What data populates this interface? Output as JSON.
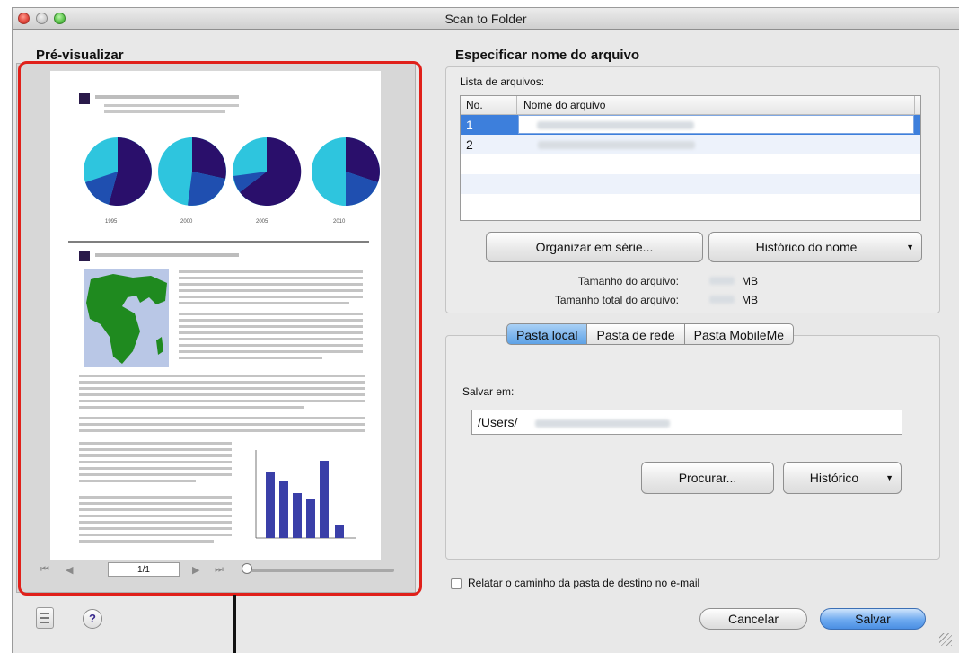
{
  "window": {
    "title": "Scan to Folder"
  },
  "preview": {
    "title": "Pré-visualizar",
    "page_indicator": "1/1",
    "chart_years": [
      "1995",
      "2000",
      "2005",
      "2010"
    ]
  },
  "filename_section": {
    "title": "Especificar nome do arquivo",
    "list_label": "Lista de arquivos:",
    "columns": [
      "No.",
      "Nome do arquivo"
    ],
    "rows": [
      {
        "no": "1"
      },
      {
        "no": "2"
      }
    ],
    "organize_button": "Organizar em série...",
    "history_button": "Histórico do nome",
    "file_size_label": "Tamanho do arquivo:",
    "file_size_unit": "MB",
    "total_size_label": "Tamanho total do arquivo:",
    "total_size_unit": "MB"
  },
  "folder_tabs": {
    "tabs": [
      "Pasta local",
      "Pasta de rede",
      "Pasta MobileMe"
    ],
    "active": "Pasta local"
  },
  "save_in": {
    "label": "Salvar em:",
    "path_prefix": "/Users/",
    "browse_button": "Procurar...",
    "history_button": "Histórico"
  },
  "report_checkbox": {
    "label": "Relatar o caminho da pasta de destino no e-mail",
    "checked": false
  },
  "footer": {
    "cancel_button": "Cancelar",
    "save_button": "Salvar"
  },
  "colors": {
    "highlight": "#e0201a",
    "selection": "#3d7fdc",
    "pie_dark": "#2a0f6b",
    "pie_mid": "#1f4fb0",
    "pie_light": "#2ec5de",
    "bars": "#3a3fa8",
    "map_land": "#1f8a1f",
    "map_sea": "#b9c7e6"
  }
}
